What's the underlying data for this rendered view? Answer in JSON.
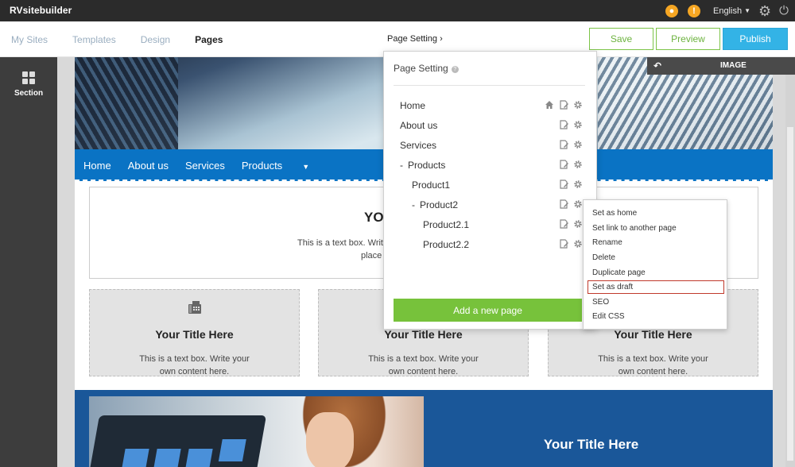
{
  "app": {
    "brand": "RVsitebuilder",
    "language": "English",
    "notification_icon": "bell-icon",
    "alert_icon": "alert-icon",
    "accent_orange": "#f5a623"
  },
  "secondary_nav": {
    "items": [
      {
        "label": "My Sites",
        "active": false
      },
      {
        "label": "Templates",
        "active": false
      },
      {
        "label": "Design",
        "active": false
      },
      {
        "label": "Pages",
        "active": true
      }
    ],
    "crumb": "Page Setting",
    "crumb_chevron": "›",
    "save_label": "Save",
    "preview_label": "Preview",
    "publish_label": "Publish"
  },
  "sidebar": {
    "section_label": "Section"
  },
  "image_strip": {
    "label": "IMAGE"
  },
  "site": {
    "nav": [
      "Home",
      "About us",
      "Services",
      "Products"
    ],
    "textbox": {
      "title": "YO",
      "line1": "This is a text box. Write",
      "line2": "place"
    },
    "cards": [
      {
        "title": "Your Title Here",
        "text1": "This is a text box. Write your",
        "text2": "own content here."
      },
      {
        "title": "Your Title Here",
        "text1": "This is a text box. Write your",
        "text2": "own content here."
      },
      {
        "title": "Your Title Here",
        "text1": "This is a text box. Write your",
        "text2": "own content here."
      }
    ],
    "bottom_title": "Your Title Here"
  },
  "page_setting": {
    "title": "Page Setting",
    "help_glyph": "?",
    "pages": [
      {
        "label": "Home",
        "level": 0,
        "dash": false,
        "home": true
      },
      {
        "label": "About us",
        "level": 0,
        "dash": false,
        "home": false
      },
      {
        "label": "Services",
        "level": 0,
        "dash": false,
        "home": false
      },
      {
        "label": "Products",
        "level": 0,
        "dash": true,
        "home": false
      },
      {
        "label": "Product1",
        "level": 1,
        "dash": false,
        "home": false
      },
      {
        "label": "Product2",
        "level": 1,
        "dash": true,
        "home": false
      },
      {
        "label": "Product2.1",
        "level": 2,
        "dash": false,
        "home": false
      },
      {
        "label": "Product2.2",
        "level": 2,
        "dash": false,
        "home": false
      }
    ],
    "add_label": "Add a new page",
    "add_color": "#77c23b"
  },
  "context_menu": {
    "items": [
      "Set as home",
      "Set link to another page",
      "Rename",
      "Delete",
      "Duplicate page",
      "Set as draft",
      "SEO",
      "Edit CSS"
    ],
    "highlighted": "Set as draft",
    "highlight_color": "#c0392b"
  }
}
